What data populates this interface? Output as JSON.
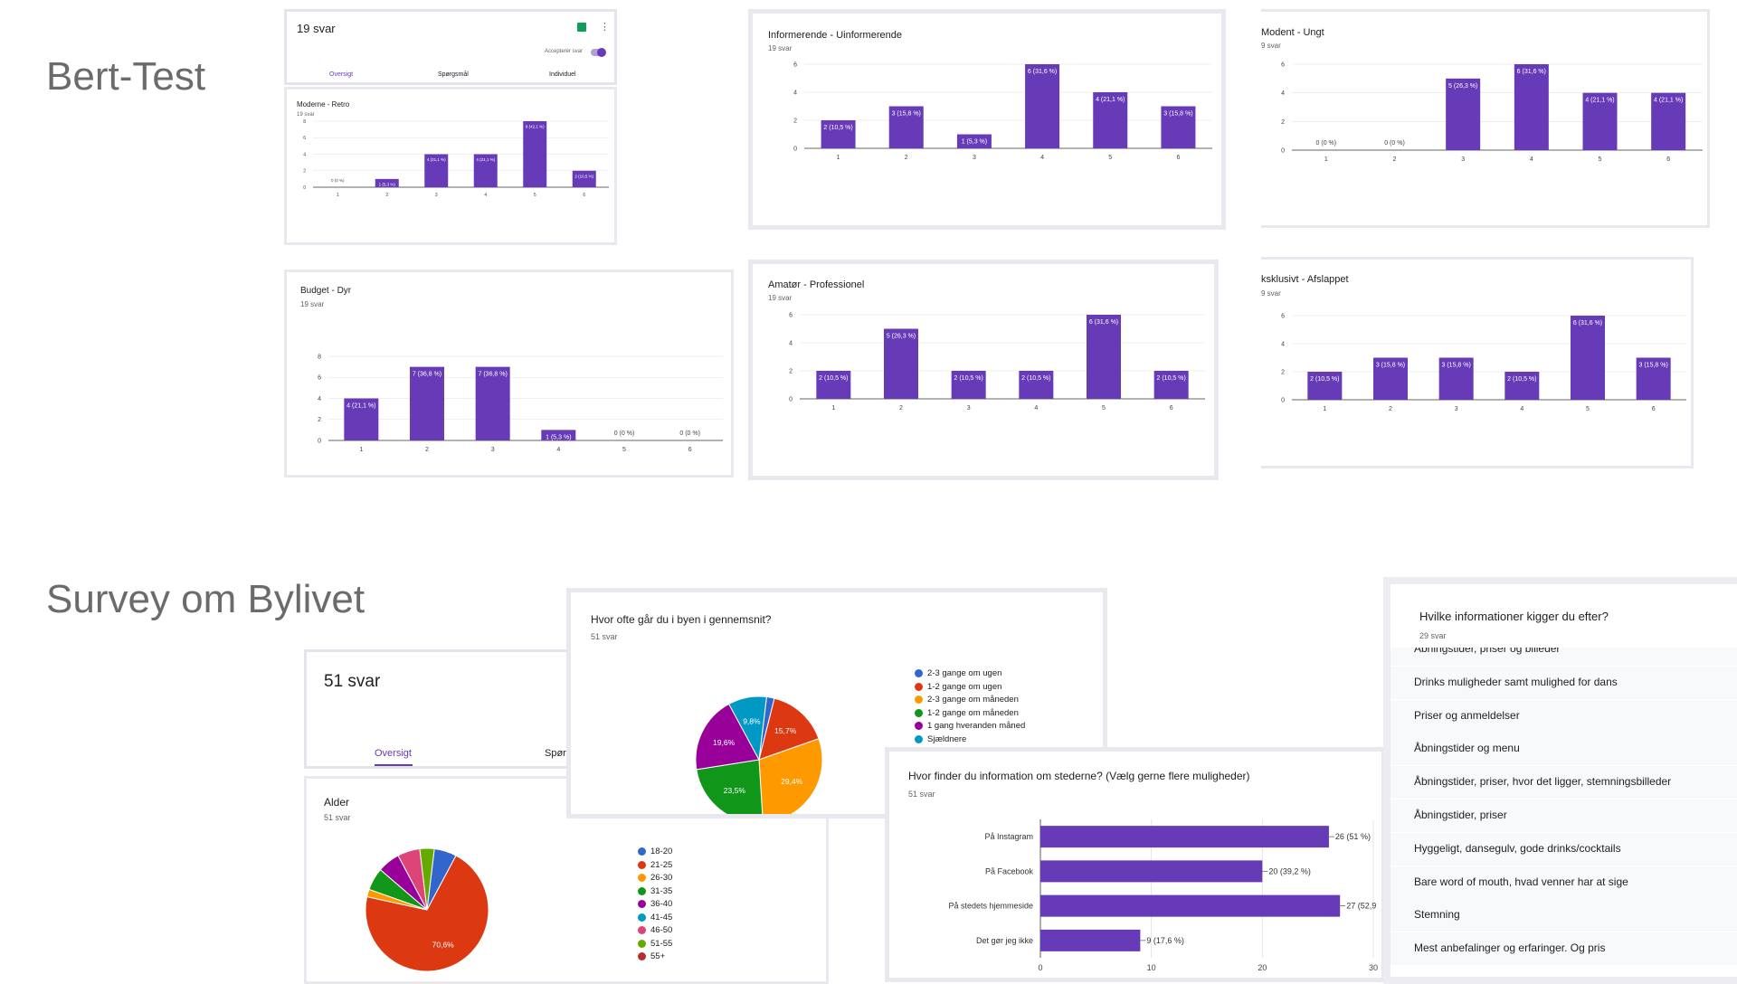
{
  "sections": {
    "bert_test": "Bert-Test",
    "survey": "Survey om Bylivet"
  },
  "summary1": {
    "count": "19 svar",
    "accept_label": "Accepterer svar",
    "tabs": [
      "Oversigt",
      "Spørgsmål",
      "Individuel"
    ]
  },
  "summary2": {
    "count": "51 svar",
    "tab_active": "Oversigt",
    "tab_partial": "Spørg"
  },
  "bar_cards": [
    {
      "title": "Moderne - Retro",
      "sub": "19 svar"
    },
    {
      "title": "Informerende - Uinformerende",
      "sub": "19 svar"
    },
    {
      "title": "Modent - Ungt",
      "sub": "9 svar"
    },
    {
      "title": "Budget - Dyr",
      "sub": "19 svar"
    },
    {
      "title": "Amatør - Professionel",
      "sub": "19 svar"
    },
    {
      "title": "ksklusivt - Afslappet",
      "sub": "9 svar"
    }
  ],
  "pie_cards": [
    {
      "title": "Hvor ofte går du i byen i gennemsnit?",
      "sub": "51 svar"
    },
    {
      "title": "Alder",
      "sub": "51 svar"
    }
  ],
  "hbar_card": {
    "title": "Hvor finder du information om stederne? (Vælg gerne flere muligheder)",
    "sub": "51 svar"
  },
  "list_card": {
    "title": "Hvilke informationer kigger du efter?",
    "sub": "29 svar",
    "items": [
      "Abningstider, priser og billeder",
      "Drinks muligheder samt mulighed for dans",
      "Priser og anmeldelser",
      "Åbningstider og menu",
      "Åbningstider, priser, hvor det ligger, stemningsbilleder",
      "Åbningstider, priser",
      "Hyggeligt, dansegulv, gode drinks/cocktails",
      "Bare word of mouth, hvad venner har at sige",
      "Stemning",
      "Mest anbefalinger og erfaringer. Og pris"
    ]
  },
  "colors": {
    "accent": "#673ab7",
    "bar": "#673ab7",
    "toggle": "#673ab7",
    "sheets": "#0f9d58"
  },
  "chart_data": [
    {
      "type": "bar",
      "title": "Moderne - Retro",
      "categories": [
        "1",
        "2",
        "3",
        "4",
        "5",
        "6"
      ],
      "values": [
        0,
        1,
        4,
        4,
        8,
        2
      ],
      "labels": [
        "0 (0 %)",
        "1 (5,3 %)",
        "4 (21,1 %)",
        "4 (21,1 %)",
        "8 (42,1 %)",
        "2 (10,5 %)"
      ],
      "ylim": [
        0,
        8
      ],
      "yticks": [
        0,
        2,
        4,
        6,
        8
      ]
    },
    {
      "type": "bar",
      "title": "Informerende - Uinformerende",
      "categories": [
        "1",
        "2",
        "3",
        "4",
        "5",
        "6"
      ],
      "values": [
        2,
        3,
        1,
        6,
        4,
        3
      ],
      "labels": [
        "2 (10,5 %)",
        "3 (15,8 %)",
        "1 (5,3 %)",
        "6 (31,6 %)",
        "4 (21,1 %)",
        "3 (15,8 %)"
      ],
      "ylim": [
        0,
        6
      ],
      "yticks": [
        0,
        2,
        4,
        6
      ]
    },
    {
      "type": "bar",
      "title": "Modent - Ungt",
      "categories": [
        "1",
        "2",
        "3",
        "4",
        "5",
        "6"
      ],
      "values": [
        0,
        0,
        5,
        6,
        4,
        4
      ],
      "labels": [
        "0 (0 %)",
        "0 (0 %)",
        "5 (26,3 %)",
        "6 (31,6 %)",
        "4 (21,1 %)",
        "4 (21,1 %)"
      ],
      "ylim": [
        0,
        6
      ],
      "yticks": [
        0,
        2,
        4,
        6
      ]
    },
    {
      "type": "bar",
      "title": "Budget - Dyr",
      "categories": [
        "1",
        "2",
        "3",
        "4",
        "5",
        "6"
      ],
      "values": [
        4,
        7,
        7,
        1,
        0,
        0
      ],
      "labels": [
        "4 (21,1 %)",
        "7 (36,8 %)",
        "7 (36,8 %)",
        "1 (5,3 %)",
        "0 (0 %)",
        "0 (0 %)"
      ],
      "ylim": [
        0,
        8
      ],
      "yticks": [
        0,
        2,
        4,
        6,
        8
      ]
    },
    {
      "type": "bar",
      "title": "Amatør - Professionel",
      "categories": [
        "1",
        "2",
        "3",
        "4",
        "5",
        "6"
      ],
      "values": [
        2,
        5,
        2,
        2,
        6,
        2
      ],
      "labels": [
        "2 (10,5 %)",
        "5 (26,3 %)",
        "2 (10,5 %)",
        "2 (10,5 %)",
        "6 (31,6 %)",
        "2 (10,5 %)"
      ],
      "ylim": [
        0,
        6
      ],
      "yticks": [
        0,
        2,
        4,
        6
      ]
    },
    {
      "type": "bar",
      "title": "ksklusivt - Afslappet",
      "categories": [
        "1",
        "2",
        "3",
        "4",
        "5",
        "6"
      ],
      "values": [
        2,
        3,
        3,
        2,
        6,
        3
      ],
      "labels": [
        "2 (10,5 %)",
        "3 (15,8 %)",
        "3 (15,8 %)",
        "2 (10,5 %)",
        "6 (31,6 %)",
        "3 (15,8 %)"
      ],
      "ylim": [
        0,
        6
      ],
      "yticks": [
        0,
        2,
        4,
        6
      ]
    },
    {
      "type": "pie",
      "title": "Hvor ofte går du i byen i gennemsnit?",
      "slices": [
        {
          "label": "2-3 gange om ugen",
          "value": 2.0,
          "color": "#3366cc",
          "text": ""
        },
        {
          "label": "1-2 gange om ugen",
          "value": 15.7,
          "color": "#dc3912",
          "text": "15,7%"
        },
        {
          "label": "2-3 gange om måneden",
          "value": 29.4,
          "color": "#ff9900",
          "text": "29,4%"
        },
        {
          "label": "1-2 gange om måneden",
          "value": 23.5,
          "color": "#109618",
          "text": "23,5%"
        },
        {
          "label": "1 gang hveranden måned",
          "value": 19.6,
          "color": "#990099",
          "text": "19,6%"
        },
        {
          "label": "Sjældnere",
          "value": 9.8,
          "color": "#0099c6",
          "text": "9,8%"
        }
      ]
    },
    {
      "type": "pie",
      "title": "Alder",
      "slices": [
        {
          "label": "18-20",
          "value": 5.9,
          "color": "#3366cc",
          "text": ""
        },
        {
          "label": "21-25",
          "value": 70.6,
          "color": "#dc3912",
          "text": "70,6%"
        },
        {
          "label": "26-30",
          "value": 2.0,
          "color": "#ff9900",
          "text": ""
        },
        {
          "label": "31-35",
          "value": 5.9,
          "color": "#109618",
          "text": ""
        },
        {
          "label": "36-40",
          "value": 5.9,
          "color": "#990099",
          "text": ""
        },
        {
          "label": "41-45",
          "value": 0,
          "color": "#0099c6",
          "text": ""
        },
        {
          "label": "46-50",
          "value": 5.9,
          "color": "#dd4477",
          "text": ""
        },
        {
          "label": "51-55",
          "value": 3.8,
          "color": "#66aa00",
          "text": ""
        },
        {
          "label": "55+",
          "value": 0,
          "color": "#b82e2e",
          "text": ""
        }
      ]
    },
    {
      "type": "bar",
      "orientation": "horizontal",
      "title": "Hvor finder du information om stederne? (Vælg gerne flere muligheder)",
      "categories": [
        "På Instagram",
        "På Facebook",
        "På stedets hjemmeside",
        "Det gør jeg ikke"
      ],
      "values": [
        26,
        20,
        27,
        9
      ],
      "labels": [
        "26 (51 %)",
        "20 (39,2 %)",
        "27 (52,9",
        "9 (17,6 %)"
      ],
      "xlim": [
        0,
        30
      ],
      "xticks": [
        0,
        10,
        20,
        30
      ]
    }
  ]
}
